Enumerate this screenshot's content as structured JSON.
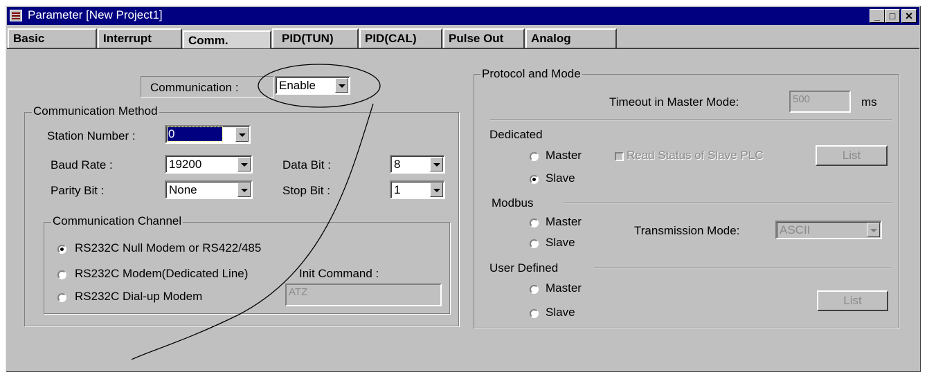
{
  "window": {
    "title": "Parameter [New Project1]",
    "minimize": "_",
    "maximize": "□",
    "close": "✕"
  },
  "tabs": [
    "Basic",
    "Interrupt",
    "Comm.",
    "PID(TUN)",
    "PID(CAL)",
    "Pulse Out",
    "Analog"
  ],
  "comm": {
    "label": "Communication :",
    "value": "Enable"
  },
  "method": {
    "legend": "Communication Method",
    "station_label": "Station Number :",
    "station_value": "0",
    "baud_label": "Baud Rate :",
    "baud_value": "19200",
    "parity_label": "Parity Bit :",
    "parity_value": "None",
    "databit_label": "Data Bit :",
    "databit_value": "8",
    "stopbit_label": "Stop Bit :",
    "stopbit_value": "1"
  },
  "channel": {
    "legend": "Communication Channel",
    "options": [
      "RS232C Null Modem or RS422/485",
      "RS232C Modem(Dedicated Line)",
      "RS232C Dial-up Modem"
    ],
    "selected_index": 0,
    "init_label": "Init Command :",
    "init_value": "ATZ"
  },
  "protocol": {
    "legend": "Protocol and Mode",
    "timeout_label": "Timeout in Master Mode:",
    "timeout_value": "500",
    "timeout_unit": "ms",
    "dedicated_label": "Dedicated",
    "dedicated_master": "Master",
    "dedicated_slave": "Slave",
    "dedicated_selected": "Slave",
    "read_status_label": "Read Status of Slave PLC",
    "list_label": "List",
    "modbus_label": "Modbus",
    "modbus_master": "Master",
    "modbus_slave": "Slave",
    "transmission_label": "Transmission Mode:",
    "transmission_value": "ASCII",
    "user_label": "User Defined",
    "user_master": "Master",
    "user_slave": "Slave",
    "user_list_label": "List"
  }
}
